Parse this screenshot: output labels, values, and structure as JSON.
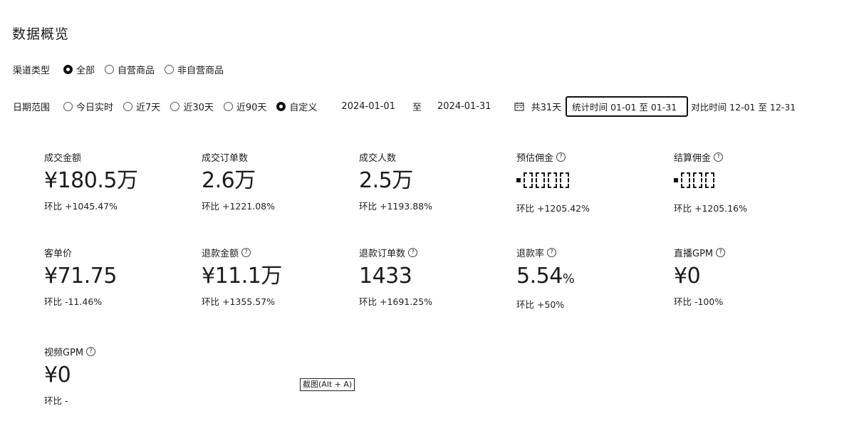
{
  "page": {
    "title": "数据概览"
  },
  "channel": {
    "label": "渠道类型",
    "options": [
      "全部",
      "自营商品",
      "非自营商品"
    ],
    "selected": "全部"
  },
  "date": {
    "label": "日期范围",
    "options": [
      "今日实时",
      "近7天",
      "近30天",
      "近90天",
      "自定义"
    ],
    "selected": "自定义",
    "start": "2024-01-01",
    "separator": "至",
    "end": "2024-01-31",
    "calendar_icon": "calendar-icon",
    "days": "共31天",
    "stat_time": "统计时间 01-01 至 01-31",
    "compare_time": "对比时间 12-01 至 12-31"
  },
  "metrics": [
    {
      "label": "成交金额",
      "value": "¥180.5万",
      "change": "环比 +1045.47%",
      "help": false
    },
    {
      "label": "成交订单数",
      "value": "2.6万",
      "change": "环比 +1221.08%",
      "help": false
    },
    {
      "label": "成交人数",
      "value": "2.5万",
      "change": "环比 +1193.88%",
      "help": false
    },
    {
      "label": "预估佣金",
      "value": "",
      "change": "环比 +1205.42%",
      "help": true,
      "masked": true
    },
    {
      "label": "结算佣金",
      "value": "",
      "change": "环比 +1205.16%",
      "help": true,
      "masked": true
    },
    {
      "label": "客单价",
      "value": "¥71.75",
      "change": "环比 -11.46%",
      "help": false
    },
    {
      "label": "退款金额",
      "value": "¥11.1万",
      "change": "环比 +1355.57%",
      "help": true
    },
    {
      "label": "退款订单数",
      "value": "1433",
      "change": "环比 +1691.25%",
      "help": true
    },
    {
      "label": "退款率",
      "value": "5.54",
      "unit": "%",
      "change": "环比 +50%",
      "help": true
    },
    {
      "label": "直播GPM",
      "value": "¥0",
      "change": "环比 -100%",
      "help": true
    },
    {
      "label": "视频GPM",
      "value": "¥0",
      "change": "环比 -",
      "help": true
    }
  ],
  "tooltip": "截图(Alt + A)",
  "help_glyph": "?"
}
